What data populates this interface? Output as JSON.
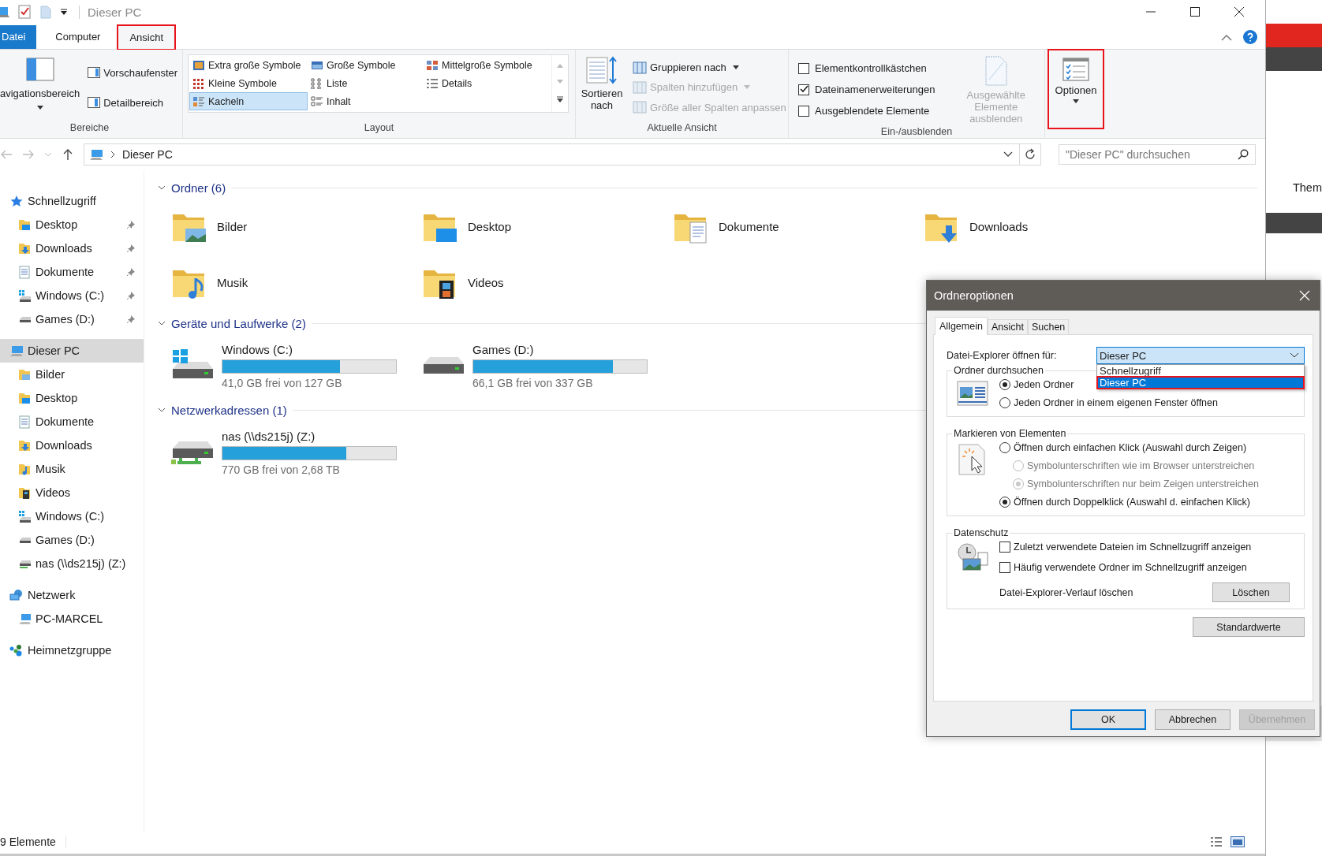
{
  "window": {
    "title": "Dieser PC"
  },
  "ribbon_tabs": [
    {
      "label": "Datei",
      "kind": "file",
      "selected": false,
      "highlighted": false
    },
    {
      "label": "Computer",
      "kind": "tab",
      "selected": false,
      "highlighted": false
    },
    {
      "label": "Ansicht",
      "kind": "tab",
      "selected": true,
      "highlighted": true
    }
  ],
  "panes": {
    "label": "Bereiche",
    "large": "avigationsbereich",
    "items": [
      "Vorschaufenster",
      "Detailbereich"
    ]
  },
  "layout": {
    "label": "Layout",
    "items": [
      {
        "label": "Extra große Symbole",
        "selected": false
      },
      {
        "label": "Große Symbole",
        "selected": false
      },
      {
        "label": "Mittelgroße Symbole",
        "selected": false
      },
      {
        "label": "Kleine Symbole",
        "selected": false
      },
      {
        "label": "Liste",
        "selected": false
      },
      {
        "label": "Details",
        "selected": false
      },
      {
        "label": "Kacheln",
        "selected": true
      },
      {
        "label": "Inhalt",
        "selected": false
      }
    ]
  },
  "current_view": {
    "label": "Aktuelle Ansicht",
    "sort": "Sortieren nach",
    "items": [
      {
        "label": "Gruppieren nach",
        "disabled": false
      },
      {
        "label": "Spalten hinzufügen",
        "disabled": true
      },
      {
        "label": "Größe aller Spalten anpassen",
        "disabled": true
      }
    ]
  },
  "show_hide": {
    "label": "Ein-/ausblenden",
    "checkboxes": [
      {
        "label": "Elementkontrollkästchen",
        "checked": false
      },
      {
        "label": "Dateinamenerweiterungen",
        "checked": true
      },
      {
        "label": "Ausgeblendete Elemente",
        "checked": false
      }
    ],
    "hide_selected": {
      "label": "Ausgewählte Elemente ausblenden",
      "disabled": true
    }
  },
  "options": {
    "label": "Optionen",
    "highlighted": true
  },
  "address": {
    "path": "Dieser PC"
  },
  "search": {
    "placeholder": "\"Dieser PC\" durchsuchen"
  },
  "sidebar": {
    "items": [
      {
        "label": "Schnellzugriff",
        "kind": "star",
        "selected": false,
        "children": [
          {
            "label": "Desktop",
            "kind": "desktop",
            "pinned": true
          },
          {
            "label": "Downloads",
            "kind": "downloads",
            "pinned": true
          },
          {
            "label": "Dokumente",
            "kind": "documents",
            "pinned": true
          },
          {
            "label": "Windows (C:)",
            "kind": "windows-drive",
            "pinned": true
          },
          {
            "label": "Games (D:)",
            "kind": "drive",
            "pinned": true
          }
        ]
      },
      {
        "label": "Dieser PC",
        "kind": "pc",
        "selected": true,
        "children": [
          {
            "label": "Bilder",
            "kind": "pictures",
            "pinned": false
          },
          {
            "label": "Desktop",
            "kind": "desktop",
            "pinned": false
          },
          {
            "label": "Dokumente",
            "kind": "documents",
            "pinned": false
          },
          {
            "label": "Downloads",
            "kind": "downloads",
            "pinned": false
          },
          {
            "label": "Musik",
            "kind": "music",
            "pinned": false
          },
          {
            "label": "Videos",
            "kind": "videos",
            "pinned": false
          },
          {
            "label": "Windows (C:)",
            "kind": "windows-drive",
            "pinned": false
          },
          {
            "label": "Games (D:)",
            "kind": "drive",
            "pinned": false
          },
          {
            "label": "nas (\\\\ds215j) (Z:)",
            "kind": "nas",
            "pinned": false
          }
        ]
      },
      {
        "label": "Netzwerk",
        "kind": "network",
        "selected": false,
        "children": [
          {
            "label": "PC-MARCEL",
            "kind": "computer",
            "pinned": false
          }
        ]
      },
      {
        "label": "Heimnetzgruppe",
        "kind": "homegroup",
        "selected": false
      }
    ]
  },
  "sections": [
    {
      "title": "Ordner (6)",
      "expanded": true,
      "kind": "folders",
      "items": [
        {
          "label": "Bilder",
          "kind": "pictures"
        },
        {
          "label": "Desktop",
          "kind": "desktop"
        },
        {
          "label": "Dokumente",
          "kind": "documents"
        },
        {
          "label": "Downloads",
          "kind": "downloads"
        },
        {
          "label": "Musik",
          "kind": "music"
        },
        {
          "label": "Videos",
          "kind": "videos"
        }
      ]
    },
    {
      "title": "Geräte und Laufwerke (2)",
      "expanded": true,
      "kind": "drives",
      "items": [
        {
          "label": "Windows (C:)",
          "kind": "windows-drive",
          "level": 0.677,
          "free": "41,0 GB frei von 127 GB"
        },
        {
          "label": "Games (D:)",
          "kind": "drive",
          "level": 0.804,
          "free": "66,1 GB frei von 337 GB"
        }
      ]
    },
    {
      "title": "Netzwerkadressen (1)",
      "expanded": true,
      "kind": "drives",
      "items": [
        {
          "label": "nas (\\\\ds215j) (Z:)",
          "kind": "nas",
          "level": 0.713,
          "free": "770 GB frei von 2,68 TB"
        }
      ]
    }
  ],
  "status_bar": {
    "count": "9 Elemente"
  },
  "background_window": {
    "text": "Them"
  },
  "dialog": {
    "title": "Ordneroptionen",
    "tabs": [
      {
        "label": "Allgemein",
        "selected": true
      },
      {
        "label": "Ansicht",
        "selected": false
      },
      {
        "label": "Suchen",
        "selected": false
      }
    ],
    "open_for": {
      "label": "Datei-Explorer öffnen für:",
      "value": "Dieser PC",
      "expanded": true,
      "options": [
        {
          "label": "Schnellzugriff",
          "selected": false,
          "highlighted": false
        },
        {
          "label": "Dieser PC",
          "selected": true,
          "highlighted": true
        }
      ]
    },
    "groups": [
      {
        "title": "Ordner durchsuchen",
        "kind": "browse",
        "radios": [
          {
            "label": "Jeden Ordner",
            "selected": true,
            "disabled": false
          },
          {
            "label": "Jeden Ordner in einem eigenen Fenster öffnen",
            "selected": false,
            "disabled": false
          }
        ]
      },
      {
        "title": "Markieren von Elementen",
        "kind": "click",
        "radios": [
          {
            "label": "Öffnen durch einfachen Klick (Auswahl durch Zeigen)",
            "selected": false,
            "disabled": false,
            "children": [
              {
                "label": "Symbolunterschriften wie im Browser unterstreichen",
                "selected": false,
                "disabled": true
              },
              {
                "label": "Symbolunterschriften nur beim Zeigen unterstreichen",
                "selected": true,
                "disabled": true
              }
            ]
          },
          {
            "label": "Öffnen durch Doppelklick (Auswahl d. einfachen Klick)",
            "selected": true,
            "disabled": false
          }
        ]
      },
      {
        "title": "Datenschutz",
        "kind": "privacy",
        "checkboxes": [
          {
            "label": "Zuletzt verwendete Dateien im Schnellzugriff anzeigen",
            "checked": false
          },
          {
            "label": "Häufig verwendete Ordner im Schnellzugriff anzeigen",
            "checked": false
          }
        ],
        "clear": {
          "label": "Datei-Explorer-Verlauf löschen",
          "button": "Löschen"
        }
      }
    ],
    "defaults_button": "Standardwerte",
    "buttons": [
      {
        "label": "OK",
        "kind": "primary",
        "disabled": false
      },
      {
        "label": "Abbrechen",
        "kind": "normal",
        "disabled": false
      },
      {
        "label": "Übernehmen",
        "kind": "normal",
        "disabled": true
      }
    ]
  }
}
